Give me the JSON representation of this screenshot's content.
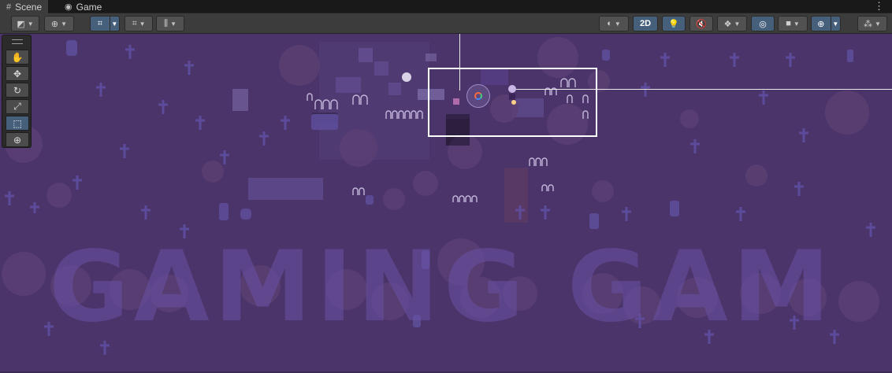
{
  "tabs": [
    {
      "label": "Scene",
      "icon": "grid-icon",
      "active": true
    },
    {
      "label": "Game",
      "icon": "gamepad-icon",
      "active": false
    }
  ],
  "toolbar": {
    "left_tools": [
      "draw-mode-icon",
      "globe-icon",
      "grid-snap-icon",
      "snap-increment-icon",
      "ruler-icon"
    ],
    "right_tools": [
      "shading-icon",
      "light-icon",
      "audio-icon",
      "effects-icon",
      "visibility-icon",
      "camera-icon",
      "gizmo-icon",
      "overlay-icon"
    ],
    "label_2d": "2D"
  },
  "tools": [
    {
      "name": "hand-tool",
      "glyph": "✋",
      "active": false
    },
    {
      "name": "move-tool",
      "glyph": "✥",
      "active": false
    },
    {
      "name": "rotate-tool",
      "glyph": "↻",
      "active": false
    },
    {
      "name": "scale-tool",
      "glyph": "⤢",
      "active": false
    },
    {
      "name": "rect-tool",
      "glyph": "⬚",
      "active": true
    },
    {
      "name": "transform-tool",
      "glyph": "⊕",
      "active": false
    }
  ],
  "scene": {
    "background": "#4a3469",
    "selection_color": "#ffffff",
    "watermark": "GAMING GAM"
  },
  "colors": {
    "toolbar_bg": "#3c3c3c",
    "tab_bg": "#191919",
    "active_tool": "#46607c"
  }
}
